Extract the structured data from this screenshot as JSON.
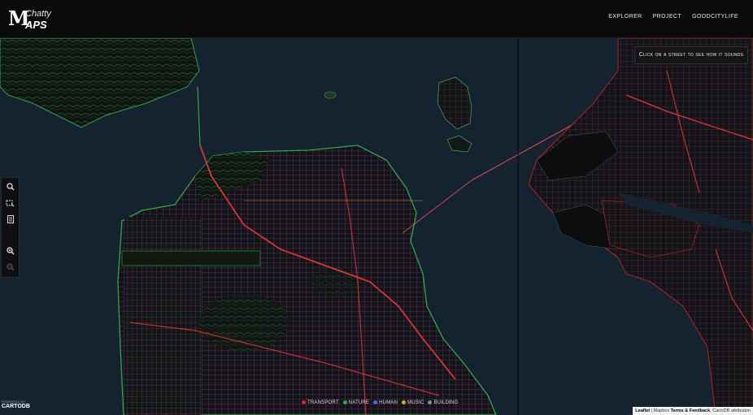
{
  "brand": {
    "logo_m": "M",
    "logo_chatty": "Chatty",
    "logo_aps": "APS"
  },
  "nav": {
    "items": [
      "EXPLORER",
      "PROJECT",
      "GOODCITYLIFE"
    ]
  },
  "map": {
    "hint": "Click on a street to see how it sounds",
    "toolbar": [
      "search-icon",
      "select-area-icon",
      "bookmark-icon",
      "zoom-in-icon",
      "zoom-out-icon"
    ],
    "legend": [
      {
        "label": "TRANSPORT",
        "color": "#e02424"
      },
      {
        "label": "NATURE",
        "color": "#2fa84a"
      },
      {
        "label": "HUMAN",
        "color": "#4a6fd6"
      },
      {
        "label": "MUSIC",
        "color": "#e6a31e"
      },
      {
        "label": "BUILDING",
        "color": "#8a8a8a"
      }
    ],
    "powered_by": "POWERED BY",
    "cartodb": "CARTODB",
    "attribution": {
      "leaflet": "Leaflet",
      "sep": "|",
      "mapbox": "Mapbox",
      "terms": "Terms & Feedback",
      "cartodb": "CartoDB attribution"
    }
  },
  "colors": {
    "water": "#152230",
    "land": "#0e1014",
    "transport": "#e02424",
    "nature": "#2fa84a",
    "human": "#4a6fd6",
    "music": "#e6a31e"
  }
}
